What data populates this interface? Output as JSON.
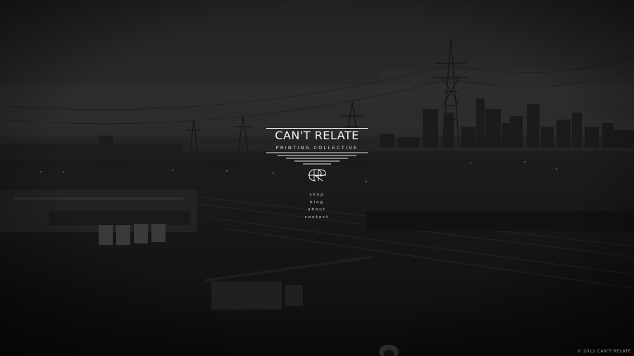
{
  "brand": {
    "title": "CAN'T RELATE",
    "subtitle": "PRINTING COLLECTIVE",
    "monogram_icon": "cr-monogram-icon"
  },
  "nav": {
    "items": [
      {
        "label": "shop"
      },
      {
        "label": "blog"
      },
      {
        "label": "about"
      },
      {
        "label": "contact"
      }
    ]
  },
  "footer": {
    "copyright": "© 2012 CAN'T RELATE"
  },
  "colors": {
    "text": "#f2f2f2",
    "background": "#0c0c0c",
    "footer_text": "#8a8a8a"
  }
}
